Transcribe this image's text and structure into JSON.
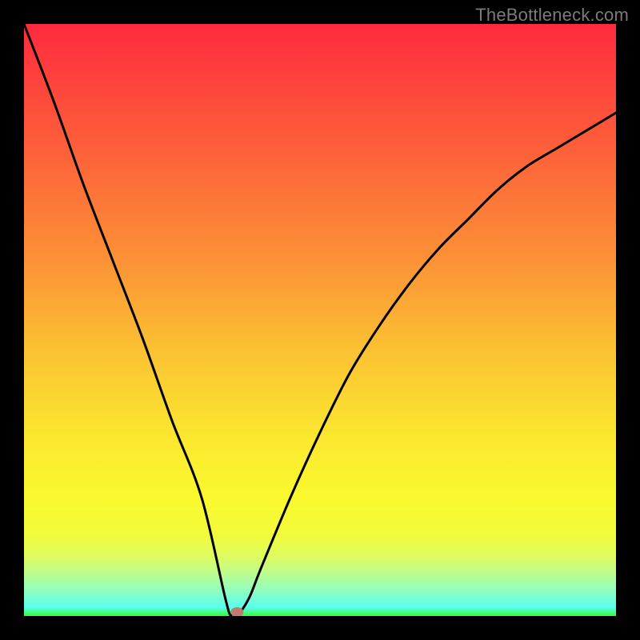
{
  "watermark": "TheBottleneck.com",
  "chart_data": {
    "type": "line",
    "title": "",
    "xlabel": "",
    "ylabel": "",
    "xlim": [
      0,
      100
    ],
    "ylim": [
      0,
      100
    ],
    "grid": false,
    "legend": false,
    "series": [
      {
        "name": "bottleneck-curve",
        "x": [
          0,
          5,
          10,
          15,
          20,
          25,
          30,
          34,
          35,
          36,
          38,
          40,
          45,
          50,
          55,
          60,
          65,
          70,
          75,
          80,
          85,
          90,
          95,
          100
        ],
        "y": [
          100,
          87,
          73,
          60,
          47,
          33,
          20,
          3,
          0,
          0,
          3,
          8,
          20,
          31,
          41,
          49,
          56,
          62,
          67,
          72,
          76,
          79,
          82,
          85
        ]
      }
    ],
    "marker": {
      "x": 36,
      "y": 0,
      "color": "#c27a70"
    },
    "background_gradient_stops": [
      {
        "offset": 0.0,
        "color": "#fe2a3e"
      },
      {
        "offset": 0.2,
        "color": "#fd5d3a"
      },
      {
        "offset": 0.4,
        "color": "#fc9236"
      },
      {
        "offset": 0.55,
        "color": "#fbc132"
      },
      {
        "offset": 0.7,
        "color": "#fbe82f"
      },
      {
        "offset": 0.8,
        "color": "#faf92e"
      },
      {
        "offset": 0.86,
        "color": "#f3fb3a"
      },
      {
        "offset": 0.9,
        "color": "#ddfc60"
      },
      {
        "offset": 0.93,
        "color": "#bafd91"
      },
      {
        "offset": 0.96,
        "color": "#8bfec5"
      },
      {
        "offset": 0.985,
        "color": "#5bfef0"
      },
      {
        "offset": 1.0,
        "color": "#33fe33"
      }
    ]
  }
}
